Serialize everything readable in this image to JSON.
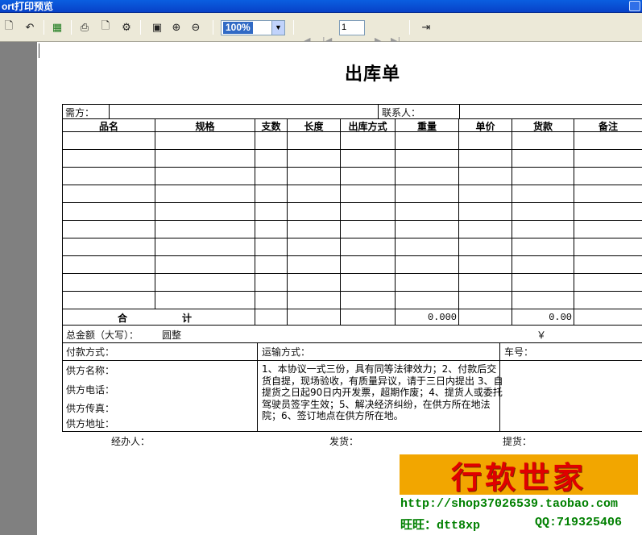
{
  "window": {
    "title": "ort打印预览"
  },
  "toolbar": {
    "zoom": "100%",
    "page": "1"
  },
  "document": {
    "title": "出库单",
    "buyer_label": "需方：",
    "contact_label": "联系人：",
    "columns": [
      "品名",
      "规格",
      "支数",
      "长度",
      "出库方式",
      "重量",
      "单价",
      "货款",
      "备注"
    ],
    "total_label_1": "合",
    "total_label_2": "计",
    "total_weight": "0.000",
    "total_amount": "0.00",
    "amount_words_label": "总金额（大写）：",
    "amount_words_value": "圆整",
    "yen": "￥",
    "payment_label": "付款方式：",
    "transport_label": "运输方式：",
    "car_no_label": "车号：",
    "supplier_name_label": "供方名称：",
    "supplier_phone_label": "供方电话：",
    "supplier_fax_label": "供方传真：",
    "supplier_addr_label": "供方地址：",
    "terms": "1、本协议一式三份，具有同等法律效力；2、付款后交货自提，现场验收，有质量异议，请于三日内提出 3、自提货之日起90日内开发票，超期作废；4、提货人或委托驾驶员签字生效；5、解决经济纠纷，在供方所在地法院；6、签订地点在供方所在地。",
    "handler_label": "经办人：",
    "ship_label": "发货：",
    "pickup_label": "提货："
  },
  "ad": {
    "banner": "行软世家",
    "url": "http://shop37026539.taobao.com",
    "wangwang": "旺旺：dtt8xp",
    "qq": "QQ:719325406"
  },
  "colors": {
    "ad_banner_bg": "#f2a600",
    "ad_banner_text": "#e00000",
    "ad_text": "#008000"
  }
}
